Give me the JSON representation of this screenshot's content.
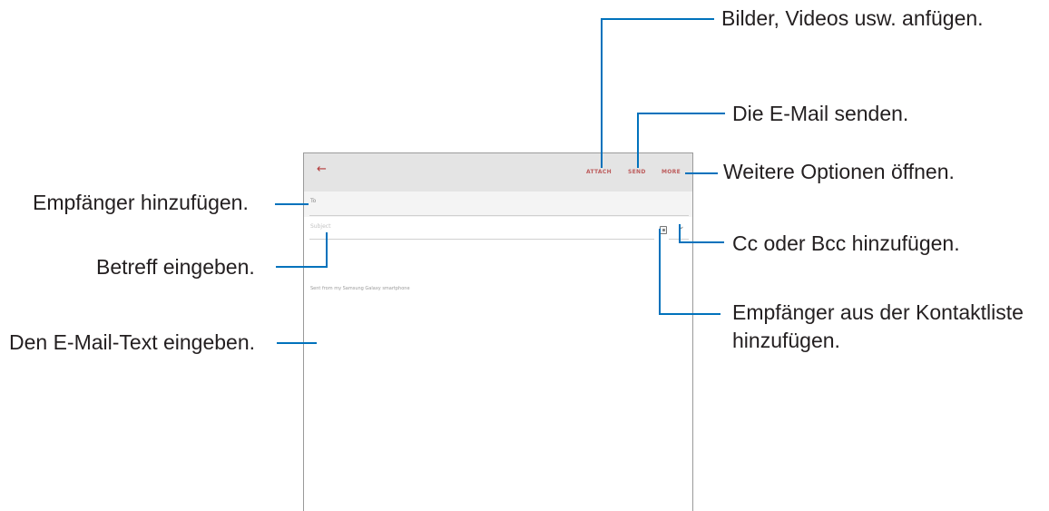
{
  "app_bar": {
    "back_icon": "arrow-left-icon",
    "attach_label": "ATTACH",
    "send_label": "SEND",
    "more_label": "MORE"
  },
  "compose": {
    "to_label": "To",
    "subject_placeholder": "Subject",
    "body_signature": "Sent from my Samsung Galaxy smartphone",
    "contacts_icon": "contact-list-icon",
    "expand_icon": "chevron-down-icon"
  },
  "callouts": {
    "attach": "Bilder, Videos usw. anfügen.",
    "send": "Die E-Mail senden.",
    "more": "Weitere Optionen öffnen.",
    "recipients": "Empfänger hinzufügen.",
    "cc_bcc": "Cc oder Bcc hinzufügen.",
    "subject": "Betreff eingeben.",
    "contacts_line1": "Empfänger aus der Kontaktliste",
    "contacts_line2": "hinzufügen.",
    "body": "Den E-Mail-Text eingeben."
  },
  "colors": {
    "callout_line": "#0072bc",
    "accent": "#b33a3a",
    "app_bar_bg": "#e4e4e4"
  }
}
